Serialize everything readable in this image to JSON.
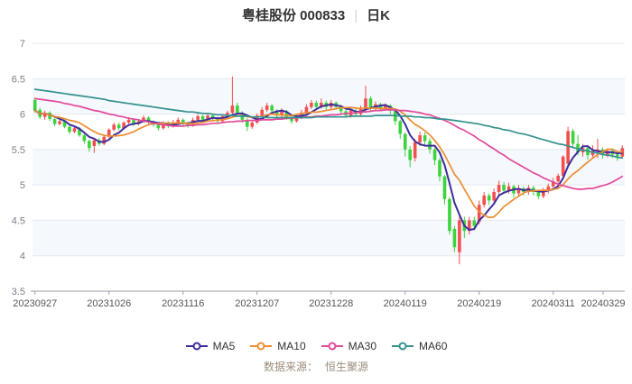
{
  "title": {
    "stock": "粤桂股份 000833",
    "separator": "|",
    "period": "日K"
  },
  "footer": {
    "source_label": "数据来源：",
    "source_name": "恒生聚源"
  },
  "chart_data": {
    "type": "candlestick",
    "title": "粤桂股份 000833 日K",
    "ylim": [
      3.5,
      7
    ],
    "ytick_interval": 0.5,
    "ytick_labels": [
      "7",
      "6.5",
      "6",
      "5.5",
      "5",
      "4.5",
      "4",
      "3.5"
    ],
    "xtick_labels": [
      "20230927",
      "20231026",
      "20231116",
      "20231207",
      "20231228",
      "20240119",
      "20240219",
      "20240311",
      "20240329"
    ],
    "xtick_indices": [
      0,
      15,
      30,
      45,
      60,
      75,
      90,
      105,
      119
    ],
    "grid": true,
    "legend_position": "bottom",
    "up_color": "#f24f4f",
    "down_color": "#3dd33d",
    "dates": [
      "20230927",
      "20230928",
      "20231009",
      "20231010",
      "20231011",
      "20231012",
      "20231013",
      "20231016",
      "20231017",
      "20231018",
      "20231019",
      "20231020",
      "20231023",
      "20231024",
      "20231025",
      "20231026",
      "20231027",
      "20231030",
      "20231031",
      "20231101",
      "20231102",
      "20231103",
      "20231106",
      "20231107",
      "20231108",
      "20231109",
      "20231110",
      "20231113",
      "20231114",
      "20231115",
      "20231116",
      "20231117",
      "20231120",
      "20231121",
      "20231122",
      "20231123",
      "20231124",
      "20231127",
      "20231128",
      "20231129",
      "20231130",
      "20231201",
      "20231204",
      "20231205",
      "20231206",
      "20231207",
      "20231208",
      "20231211",
      "20231212",
      "20231213",
      "20231214",
      "20231215",
      "20231218",
      "20231219",
      "20231220",
      "20231221",
      "20231222",
      "20231225",
      "20231226",
      "20231227",
      "20231228",
      "20231229",
      "20240102",
      "20240103",
      "20240104",
      "20240105",
      "20240108",
      "20240109",
      "20240110",
      "20240111",
      "20240112",
      "20240115",
      "20240116",
      "20240117",
      "20240118",
      "20240119",
      "20240122",
      "20240123",
      "20240124",
      "20240125",
      "20240126",
      "20240129",
      "20240130",
      "20240131",
      "20240201",
      "20240202",
      "20240205",
      "20240206",
      "20240207",
      "20240208",
      "20240219",
      "20240220",
      "20240221",
      "20240222",
      "20240223",
      "20240226",
      "20240227",
      "20240228",
      "20240229",
      "20240301",
      "20240304",
      "20240305",
      "20240306",
      "20240307",
      "20240308",
      "20240311",
      "20240312",
      "20240313",
      "20240314",
      "20240315",
      "20240318",
      "20240319",
      "20240320",
      "20240321",
      "20240322",
      "20240325",
      "20240326",
      "20240327",
      "20240328",
      "20240329"
    ],
    "ohlc_order": [
      "open",
      "high",
      "low",
      "close"
    ],
    "ohlc": [
      [
        6.2,
        6.23,
        6.02,
        6.05
      ],
      [
        6.06,
        6.09,
        5.93,
        5.96
      ],
      [
        5.96,
        6.05,
        5.92,
        6.02
      ],
      [
        6.02,
        6.04,
        5.9,
        5.93
      ],
      [
        5.93,
        5.95,
        5.83,
        5.86
      ],
      [
        5.86,
        5.93,
        5.84,
        5.9
      ],
      [
        5.9,
        5.92,
        5.8,
        5.82
      ],
      [
        5.82,
        5.84,
        5.72,
        5.75
      ],
      [
        5.75,
        5.83,
        5.73,
        5.8
      ],
      [
        5.8,
        5.82,
        5.68,
        5.7
      ],
      [
        5.7,
        5.72,
        5.58,
        5.62
      ],
      [
        5.62,
        5.64,
        5.47,
        5.52
      ],
      [
        5.55,
        5.66,
        5.45,
        5.63
      ],
      [
        5.63,
        5.66,
        5.55,
        5.58
      ],
      [
        5.58,
        5.7,
        5.56,
        5.68
      ],
      [
        5.68,
        5.8,
        5.66,
        5.78
      ],
      [
        5.78,
        5.88,
        5.76,
        5.85
      ],
      [
        5.85,
        5.88,
        5.77,
        5.8
      ],
      [
        5.8,
        5.9,
        5.78,
        5.88
      ],
      [
        5.88,
        5.96,
        5.86,
        5.92
      ],
      [
        5.92,
        5.94,
        5.83,
        5.86
      ],
      [
        5.86,
        5.93,
        5.84,
        5.9
      ],
      [
        5.9,
        5.98,
        5.88,
        5.95
      ],
      [
        5.95,
        5.97,
        5.85,
        5.88
      ],
      [
        5.88,
        5.91,
        5.82,
        5.85
      ],
      [
        5.85,
        5.87,
        5.77,
        5.8
      ],
      [
        5.8,
        5.9,
        5.78,
        5.87
      ],
      [
        5.87,
        5.9,
        5.8,
        5.83
      ],
      [
        5.83,
        5.92,
        5.81,
        5.88
      ],
      [
        5.88,
        5.95,
        5.85,
        5.92
      ],
      [
        5.92,
        5.94,
        5.84,
        5.87
      ],
      [
        5.87,
        5.9,
        5.81,
        5.84
      ],
      [
        5.84,
        5.95,
        5.82,
        5.92
      ],
      [
        5.92,
        6.0,
        5.9,
        5.97
      ],
      [
        5.97,
        5.99,
        5.89,
        5.92
      ],
      [
        5.92,
        6.02,
        5.9,
        5.98
      ],
      [
        5.98,
        6.0,
        5.91,
        5.94
      ],
      [
        5.94,
        5.96,
        5.87,
        5.9
      ],
      [
        5.9,
        6.0,
        5.88,
        5.97
      ],
      [
        5.97,
        6.05,
        5.94,
        6.02
      ],
      [
        6.02,
        6.53,
        5.99,
        6.12
      ],
      [
        6.12,
        6.16,
        5.98,
        6.02
      ],
      [
        6.02,
        6.04,
        5.88,
        5.92
      ],
      [
        5.92,
        5.94,
        5.76,
        5.82
      ],
      [
        5.82,
        5.91,
        5.79,
        5.88
      ],
      [
        5.88,
        6.01,
        5.86,
        5.98
      ],
      [
        5.98,
        6.1,
        5.96,
        6.06
      ],
      [
        6.06,
        6.16,
        6.03,
        6.12
      ],
      [
        6.12,
        6.14,
        6.01,
        6.05
      ],
      [
        6.05,
        6.07,
        5.94,
        5.98
      ],
      [
        5.98,
        6.08,
        5.96,
        6.04
      ],
      [
        6.04,
        6.06,
        5.92,
        5.96
      ],
      [
        5.96,
        5.98,
        5.86,
        5.9
      ],
      [
        5.9,
        6.0,
        5.88,
        5.96
      ],
      [
        5.96,
        6.06,
        5.93,
        6.02
      ],
      [
        6.02,
        6.14,
        5.99,
        6.1
      ],
      [
        6.1,
        6.2,
        6.07,
        6.16
      ],
      [
        6.16,
        6.19,
        6.06,
        6.1
      ],
      [
        6.1,
        6.22,
        6.08,
        6.16
      ],
      [
        6.16,
        6.19,
        6.05,
        6.1
      ],
      [
        6.1,
        6.2,
        6.07,
        6.16
      ],
      [
        6.16,
        6.18,
        6.06,
        6.1
      ],
      [
        6.1,
        6.13,
        6.0,
        6.04
      ],
      [
        6.04,
        6.06,
        5.95,
        5.98
      ],
      [
        5.98,
        6.08,
        5.95,
        6.05
      ],
      [
        6.05,
        6.08,
        5.96,
        6.0
      ],
      [
        6.0,
        6.12,
        5.97,
        6.08
      ],
      [
        6.08,
        6.4,
        6.04,
        6.22
      ],
      [
        6.22,
        6.25,
        6.04,
        6.08
      ],
      [
        6.08,
        6.18,
        6.05,
        6.14
      ],
      [
        6.14,
        6.16,
        6.04,
        6.08
      ],
      [
        6.08,
        6.15,
        6.05,
        6.12
      ],
      [
        6.12,
        6.14,
        6.0,
        6.05
      ],
      [
        6.05,
        6.06,
        5.85,
        5.9
      ],
      [
        5.9,
        5.92,
        5.65,
        5.72
      ],
      [
        5.72,
        5.74,
        5.4,
        5.5
      ],
      [
        5.5,
        5.55,
        5.25,
        5.35
      ],
      [
        5.38,
        5.65,
        5.33,
        5.6
      ],
      [
        5.6,
        5.75,
        5.55,
        5.7
      ],
      [
        5.7,
        5.74,
        5.56,
        5.62
      ],
      [
        5.62,
        5.66,
        5.44,
        5.5
      ],
      [
        5.5,
        5.53,
        5.28,
        5.35
      ],
      [
        5.35,
        5.38,
        5.05,
        5.12
      ],
      [
        5.12,
        5.14,
        4.72,
        4.8
      ],
      [
        4.8,
        4.83,
        4.3,
        4.35
      ],
      [
        4.38,
        4.42,
        4.05,
        4.12
      ],
      [
        4.05,
        4.58,
        3.88,
        4.5
      ],
      [
        4.5,
        4.55,
        4.25,
        4.35
      ],
      [
        4.35,
        4.55,
        4.3,
        4.5
      ],
      [
        4.5,
        4.55,
        4.36,
        4.42
      ],
      [
        4.48,
        4.78,
        4.44,
        4.72
      ],
      [
        4.72,
        4.9,
        4.68,
        4.85
      ],
      [
        4.85,
        4.88,
        4.72,
        4.78
      ],
      [
        4.78,
        4.95,
        4.74,
        4.9
      ],
      [
        4.9,
        5.06,
        4.86,
        5.0
      ],
      [
        5.0,
        5.04,
        4.87,
        4.92
      ],
      [
        4.92,
        5.03,
        4.88,
        4.98
      ],
      [
        4.98,
        5.0,
        4.82,
        4.88
      ],
      [
        4.88,
        5.0,
        4.84,
        4.95
      ],
      [
        4.95,
        4.98,
        4.85,
        4.9
      ],
      [
        4.9,
        5.0,
        4.86,
        4.96
      ],
      [
        4.96,
        4.99,
        4.85,
        4.9
      ],
      [
        4.9,
        4.93,
        4.8,
        4.84
      ],
      [
        4.84,
        4.96,
        4.81,
        4.92
      ],
      [
        4.92,
        5.02,
        4.88,
        4.98
      ],
      [
        4.98,
        5.1,
        4.94,
        5.05
      ],
      [
        5.05,
        5.16,
        5.0,
        5.13
      ],
      [
        5.13,
        5.42,
        5.08,
        5.4
      ],
      [
        5.3,
        5.82,
        5.24,
        5.76
      ],
      [
        5.76,
        5.79,
        5.52,
        5.58
      ],
      [
        5.58,
        5.7,
        5.42,
        5.46
      ],
      [
        5.46,
        5.58,
        5.4,
        5.52
      ],
      [
        5.52,
        5.55,
        5.36,
        5.42
      ],
      [
        5.42,
        5.56,
        5.38,
        5.48
      ],
      [
        5.48,
        5.65,
        5.38,
        5.5
      ],
      [
        5.5,
        5.53,
        5.37,
        5.42
      ],
      [
        5.42,
        5.52,
        5.39,
        5.48
      ],
      [
        5.48,
        5.51,
        5.38,
        5.43
      ],
      [
        5.43,
        5.46,
        5.34,
        5.4
      ],
      [
        5.4,
        5.56,
        5.38,
        5.52
      ]
    ],
    "ma_series": [
      {
        "name": "MA5",
        "color": "#3e2d9c",
        "window": 5
      },
      {
        "name": "MA10",
        "color": "#ed8e31",
        "window": 10
      },
      {
        "name": "MA30",
        "color": "#e24a9c",
        "values_est": [
          6.22,
          6.21,
          6.2,
          6.19,
          6.18,
          6.17,
          6.15,
          6.14,
          6.12,
          6.11,
          6.09,
          6.07,
          6.05,
          6.04,
          6.02,
          6.0,
          5.99,
          5.97,
          5.96,
          5.94,
          5.93,
          5.92,
          5.9,
          5.89,
          5.87,
          5.86,
          5.85,
          5.84,
          5.83,
          5.83,
          5.83,
          5.84,
          5.84,
          5.85,
          5.85,
          5.86,
          5.87,
          5.87,
          5.88,
          5.89,
          5.89,
          5.9,
          5.9,
          5.91,
          5.91,
          5.91,
          5.92,
          5.92,
          5.92,
          5.93,
          5.93,
          5.94,
          5.94,
          5.95,
          5.95,
          5.96,
          5.96,
          5.97,
          5.97,
          5.98,
          5.99,
          5.99,
          6.0,
          6.01,
          6.01,
          6.02,
          6.03,
          6.03,
          6.04,
          6.05,
          6.05,
          6.06,
          6.06,
          6.06,
          6.05,
          6.05,
          6.04,
          6.03,
          6.02,
          6.0,
          5.99,
          5.96,
          5.94,
          5.91,
          5.88,
          5.84,
          5.8,
          5.77,
          5.73,
          5.69,
          5.64,
          5.6,
          5.55,
          5.51,
          5.46,
          5.42,
          5.37,
          5.33,
          5.29,
          5.25,
          5.21,
          5.17,
          5.14,
          5.1,
          5.07,
          5.04,
          5.01,
          4.99,
          4.97,
          4.95,
          4.94,
          4.94,
          4.95,
          4.95,
          4.97,
          4.99,
          5.01,
          5.04,
          5.08,
          5.12
        ]
      },
      {
        "name": "MA60",
        "color": "#35928f",
        "values_est": [
          6.35,
          6.34,
          6.33,
          6.32,
          6.31,
          6.3,
          6.29,
          6.28,
          6.27,
          6.26,
          6.25,
          6.24,
          6.23,
          6.22,
          6.21,
          6.19,
          6.18,
          6.17,
          6.16,
          6.15,
          6.14,
          6.13,
          6.12,
          6.11,
          6.1,
          6.09,
          6.08,
          6.07,
          6.06,
          6.05,
          6.04,
          6.03,
          6.03,
          6.02,
          6.01,
          6.01,
          6.0,
          5.99,
          5.99,
          5.98,
          5.98,
          5.97,
          5.97,
          5.97,
          5.96,
          5.96,
          5.96,
          5.95,
          5.95,
          5.95,
          5.95,
          5.95,
          5.95,
          5.95,
          5.95,
          5.95,
          5.95,
          5.96,
          5.96,
          5.96,
          5.96,
          5.96,
          5.96,
          5.96,
          5.97,
          5.97,
          5.97,
          5.97,
          5.97,
          5.98,
          5.98,
          5.98,
          5.98,
          5.98,
          5.97,
          5.97,
          5.97,
          5.96,
          5.96,
          5.95,
          5.95,
          5.94,
          5.93,
          5.93,
          5.92,
          5.91,
          5.9,
          5.89,
          5.88,
          5.87,
          5.86,
          5.84,
          5.83,
          5.81,
          5.8,
          5.78,
          5.77,
          5.75,
          5.73,
          5.72,
          5.7,
          5.68,
          5.66,
          5.64,
          5.62,
          5.6,
          5.58,
          5.57,
          5.55,
          5.53,
          5.51,
          5.49,
          5.48,
          5.46,
          5.45,
          5.43,
          5.42,
          5.41,
          5.39,
          5.38
        ]
      }
    ]
  }
}
